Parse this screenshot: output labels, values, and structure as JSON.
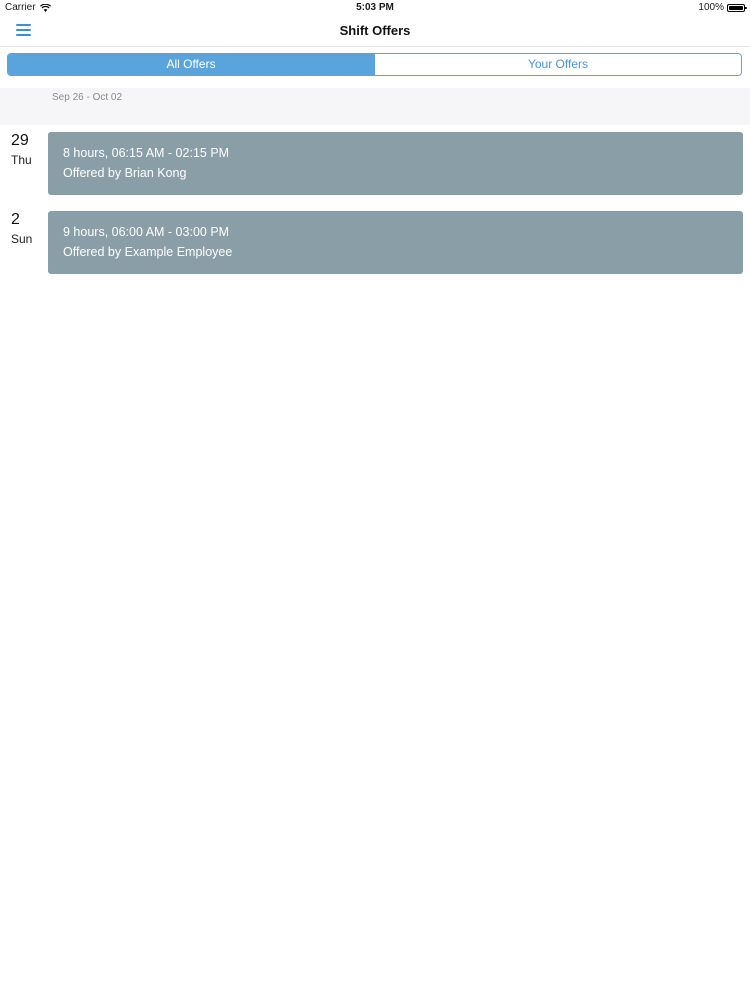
{
  "status_bar": {
    "carrier": "Carrier",
    "time": "5:03 PM",
    "battery": "100%"
  },
  "nav": {
    "title": "Shift Offers"
  },
  "tabs": [
    {
      "label": "All Offers",
      "active": true
    },
    {
      "label": "Your Offers",
      "active": false
    }
  ],
  "week": {
    "range": "Sep 26 - Oct 02"
  },
  "shifts": [
    {
      "day_num": "29",
      "day_name": "Thu",
      "hours": "8 hours, 06:15 AM - 02:15 PM",
      "offered_by": "Offered by Brian  Kong"
    },
    {
      "day_num": "2",
      "day_name": "Sun",
      "hours": "9 hours, 06:00 AM - 03:00 PM",
      "offered_by": "Offered by Example  Employee"
    }
  ],
  "colors": {
    "accent": "#5aa4dd",
    "card": "#8a9ea8"
  }
}
